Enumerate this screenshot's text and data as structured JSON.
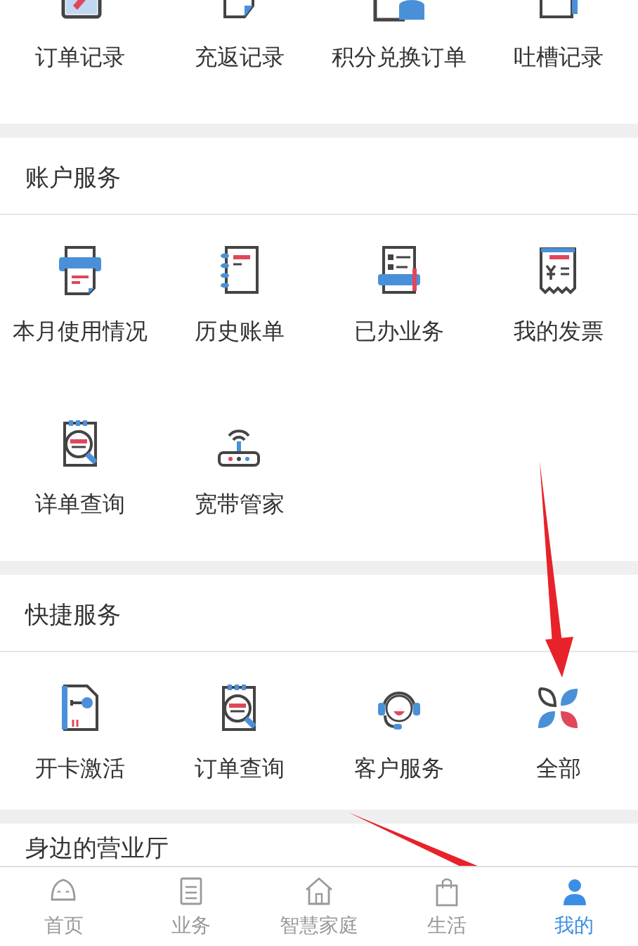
{
  "order_records": {
    "items": [
      {
        "label": "订单记录"
      },
      {
        "label": "充返记录"
      },
      {
        "label": "积分兑换订单"
      },
      {
        "label": "吐槽记录"
      }
    ]
  },
  "sections": [
    {
      "title": "账户服务",
      "items": [
        {
          "label": "本月使用情况"
        },
        {
          "label": "历史账单"
        },
        {
          "label": "已办业务"
        },
        {
          "label": "我的发票"
        },
        {
          "label": "详单查询"
        },
        {
          "label": "宽带管家"
        }
      ]
    },
    {
      "title": "快捷服务",
      "items": [
        {
          "label": "开卡激活"
        },
        {
          "label": "订单查询"
        },
        {
          "label": "客户服务"
        },
        {
          "label": "全部"
        }
      ]
    },
    {
      "title": "身边的营业厅"
    }
  ],
  "tab_bar": [
    {
      "label": "首页",
      "selected": false
    },
    {
      "label": "业务",
      "selected": false
    },
    {
      "label": "智慧家庭",
      "selected": false
    },
    {
      "label": "生活",
      "selected": false
    },
    {
      "label": "我的",
      "selected": true
    }
  ]
}
